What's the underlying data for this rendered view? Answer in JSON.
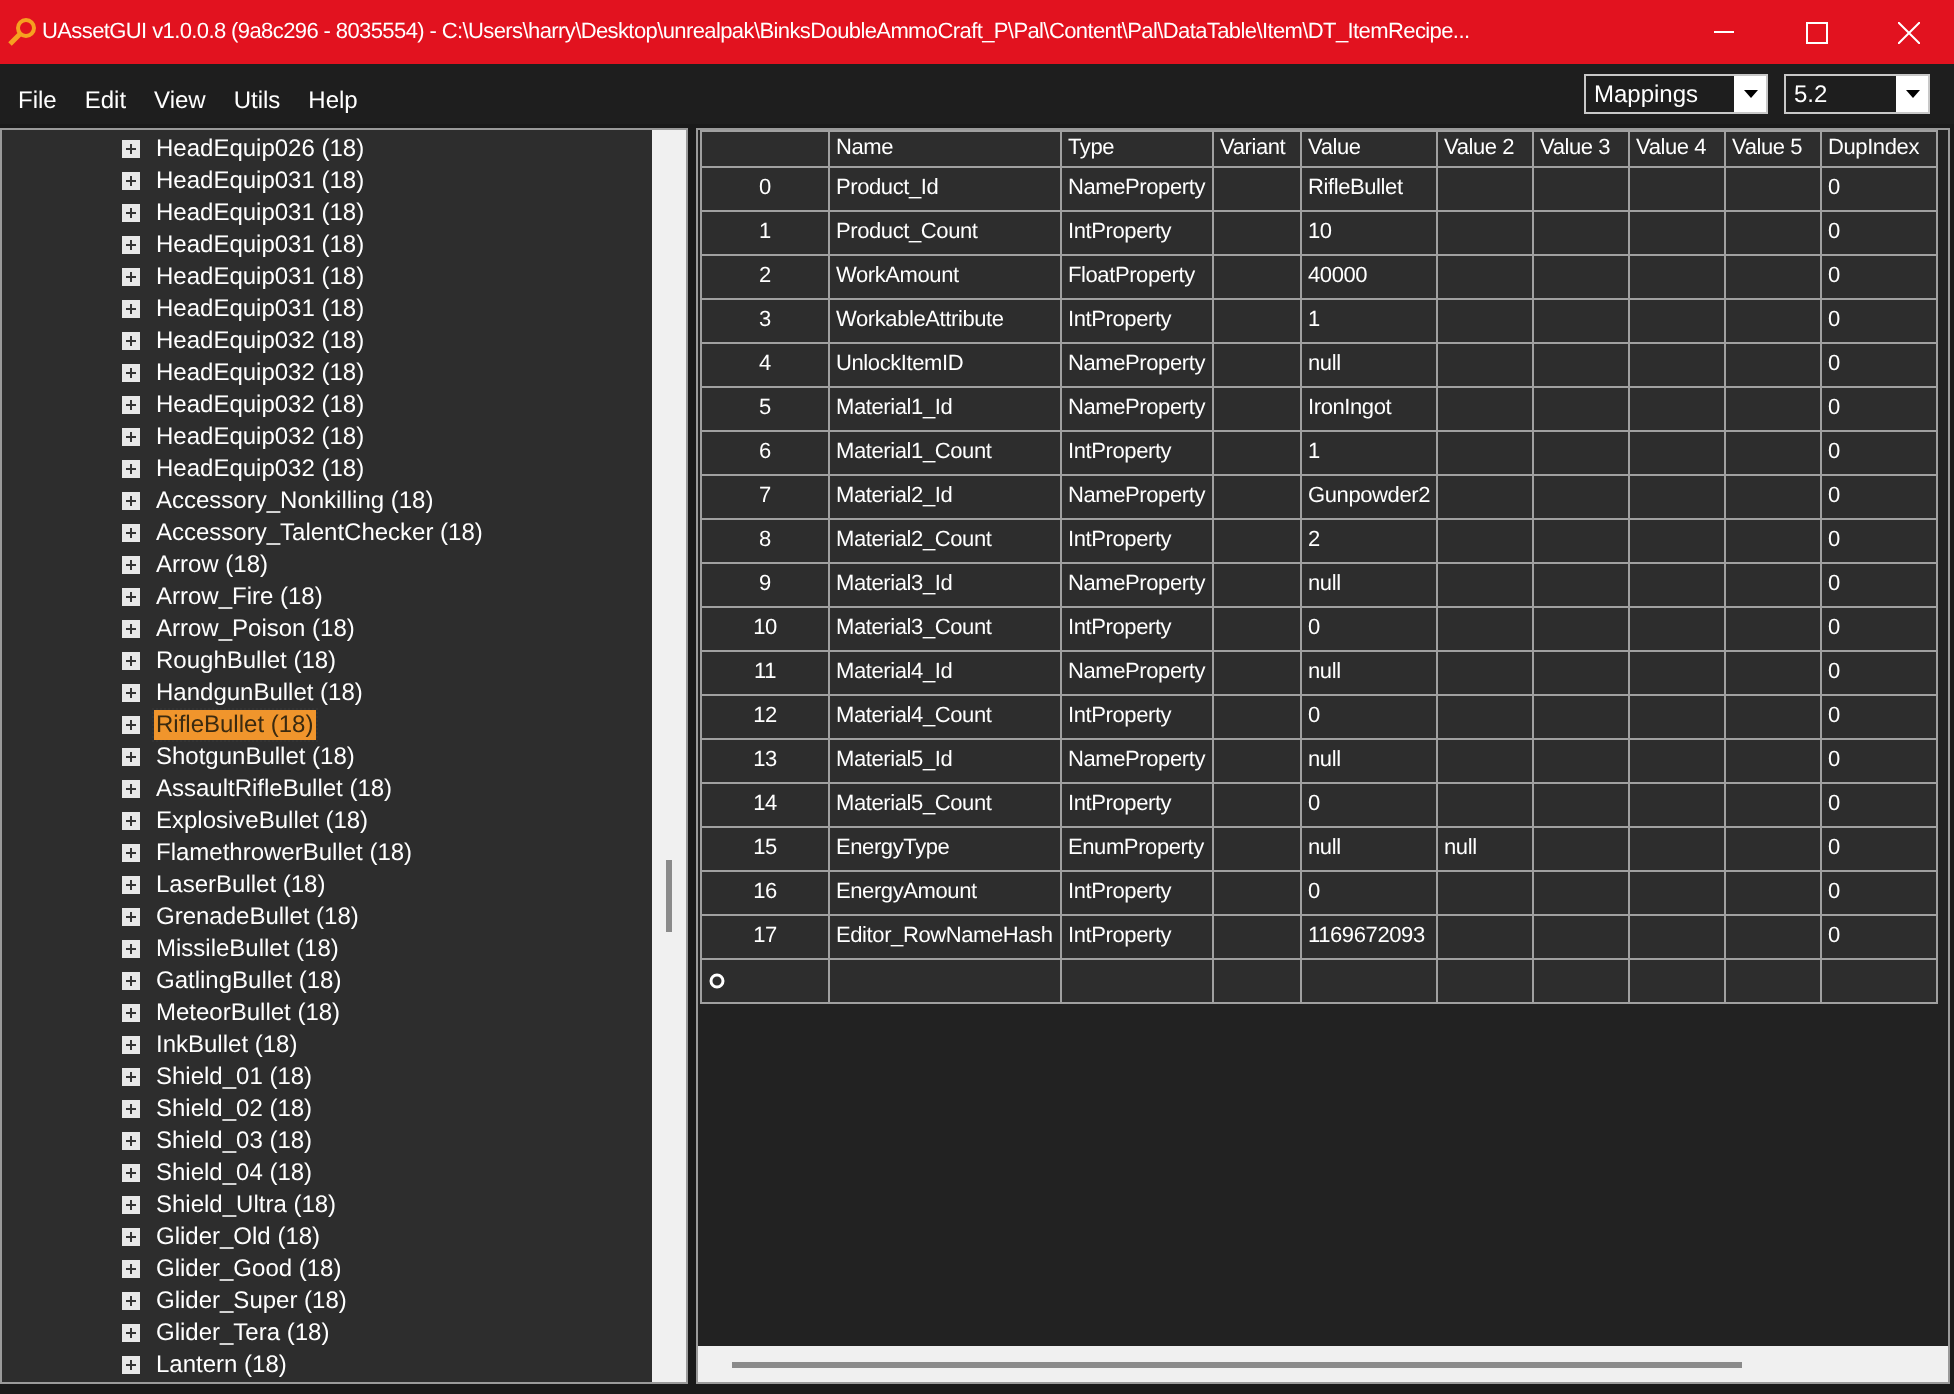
{
  "window": {
    "title": "UAssetGUI v1.0.0.8 (9a8c296 - 8035554) - C:\\Users\\harry\\Desktop\\unrealpak\\BinksDoubleAmmoCraft_P\\Pal\\Content\\Pal\\DataTable\\Item\\DT_ItemRecipe..."
  },
  "menu": [
    "File",
    "Edit",
    "View",
    "Utils",
    "Help"
  ],
  "dropdowns": [
    {
      "value": "Mappings"
    },
    {
      "value": "5.2"
    }
  ],
  "tree": {
    "items": [
      {
        "label": "HeadEquip026 (18)",
        "selected": false
      },
      {
        "label": "HeadEquip031 (18)",
        "selected": false
      },
      {
        "label": "HeadEquip031 (18)",
        "selected": false
      },
      {
        "label": "HeadEquip031 (18)",
        "selected": false
      },
      {
        "label": "HeadEquip031 (18)",
        "selected": false
      },
      {
        "label": "HeadEquip031 (18)",
        "selected": false
      },
      {
        "label": "HeadEquip032 (18)",
        "selected": false
      },
      {
        "label": "HeadEquip032 (18)",
        "selected": false
      },
      {
        "label": "HeadEquip032 (18)",
        "selected": false
      },
      {
        "label": "HeadEquip032 (18)",
        "selected": false
      },
      {
        "label": "HeadEquip032 (18)",
        "selected": false
      },
      {
        "label": "Accessory_Nonkilling (18)",
        "selected": false
      },
      {
        "label": "Accessory_TalentChecker (18)",
        "selected": false
      },
      {
        "label": "Arrow (18)",
        "selected": false
      },
      {
        "label": "Arrow_Fire (18)",
        "selected": false
      },
      {
        "label": "Arrow_Poison (18)",
        "selected": false
      },
      {
        "label": "RoughBullet (18)",
        "selected": false
      },
      {
        "label": "HandgunBullet (18)",
        "selected": false
      },
      {
        "label": "RifleBullet (18)",
        "selected": true
      },
      {
        "label": "ShotgunBullet (18)",
        "selected": false
      },
      {
        "label": "AssaultRifleBullet (18)",
        "selected": false
      },
      {
        "label": "ExplosiveBullet (18)",
        "selected": false
      },
      {
        "label": "FlamethrowerBullet (18)",
        "selected": false
      },
      {
        "label": "LaserBullet (18)",
        "selected": false
      },
      {
        "label": "GrenadeBullet (18)",
        "selected": false
      },
      {
        "label": "MissileBullet (18)",
        "selected": false
      },
      {
        "label": "GatlingBullet (18)",
        "selected": false
      },
      {
        "label": "MeteorBullet (18)",
        "selected": false
      },
      {
        "label": "InkBullet (18)",
        "selected": false
      },
      {
        "label": "Shield_01 (18)",
        "selected": false
      },
      {
        "label": "Shield_02 (18)",
        "selected": false
      },
      {
        "label": "Shield_03 (18)",
        "selected": false
      },
      {
        "label": "Shield_04 (18)",
        "selected": false
      },
      {
        "label": "Shield_Ultra (18)",
        "selected": false
      },
      {
        "label": "Glider_Old (18)",
        "selected": false
      },
      {
        "label": "Glider_Good (18)",
        "selected": false
      },
      {
        "label": "Glider_Super (18)",
        "selected": false
      },
      {
        "label": "Glider_Tera (18)",
        "selected": false
      },
      {
        "label": "Lantern (18)",
        "selected": false
      }
    ]
  },
  "table": {
    "columns": [
      "",
      "Name",
      "Type",
      "Variant",
      "Value",
      "Value 2",
      "Value 3",
      "Value 4",
      "Value 5",
      "DupIndex"
    ],
    "rows": [
      [
        "0",
        "Product_Id",
        "NameProperty",
        "",
        "RifleBullet",
        "",
        "",
        "",
        "",
        "0"
      ],
      [
        "1",
        "Product_Count",
        "IntProperty",
        "",
        "10",
        "",
        "",
        "",
        "",
        "0"
      ],
      [
        "2",
        "WorkAmount",
        "FloatProperty",
        "",
        "40000",
        "",
        "",
        "",
        "",
        "0"
      ],
      [
        "3",
        "WorkableAttribute",
        "IntProperty",
        "",
        "1",
        "",
        "",
        "",
        "",
        "0"
      ],
      [
        "4",
        "UnlockItemID",
        "NameProperty",
        "",
        "null",
        "",
        "",
        "",
        "",
        "0"
      ],
      [
        "5",
        "Material1_Id",
        "NameProperty",
        "",
        "IronIngot",
        "",
        "",
        "",
        "",
        "0"
      ],
      [
        "6",
        "Material1_Count",
        "IntProperty",
        "",
        "1",
        "",
        "",
        "",
        "",
        "0"
      ],
      [
        "7",
        "Material2_Id",
        "NameProperty",
        "",
        "Gunpowder2",
        "",
        "",
        "",
        "",
        "0"
      ],
      [
        "8",
        "Material2_Count",
        "IntProperty",
        "",
        "2",
        "",
        "",
        "",
        "",
        "0"
      ],
      [
        "9",
        "Material3_Id",
        "NameProperty",
        "",
        "null",
        "",
        "",
        "",
        "",
        "0"
      ],
      [
        "10",
        "Material3_Count",
        "IntProperty",
        "",
        "0",
        "",
        "",
        "",
        "",
        "0"
      ],
      [
        "11",
        "Material4_Id",
        "NameProperty",
        "",
        "null",
        "",
        "",
        "",
        "",
        "0"
      ],
      [
        "12",
        "Material4_Count",
        "IntProperty",
        "",
        "0",
        "",
        "",
        "",
        "",
        "0"
      ],
      [
        "13",
        "Material5_Id",
        "NameProperty",
        "",
        "null",
        "",
        "",
        "",
        "",
        "0"
      ],
      [
        "14",
        "Material5_Count",
        "IntProperty",
        "",
        "0",
        "",
        "",
        "",
        "",
        "0"
      ],
      [
        "15",
        "EnergyType",
        "EnumProperty",
        "",
        "null",
        "null",
        "",
        "",
        "",
        "0"
      ],
      [
        "16",
        "EnergyAmount",
        "IntProperty",
        "",
        "0",
        "",
        "",
        "",
        "",
        "0"
      ],
      [
        "17",
        "Editor_RowNameHash",
        "IntProperty",
        "",
        "1169672093",
        "",
        "",
        "",
        "",
        "0"
      ]
    ]
  }
}
